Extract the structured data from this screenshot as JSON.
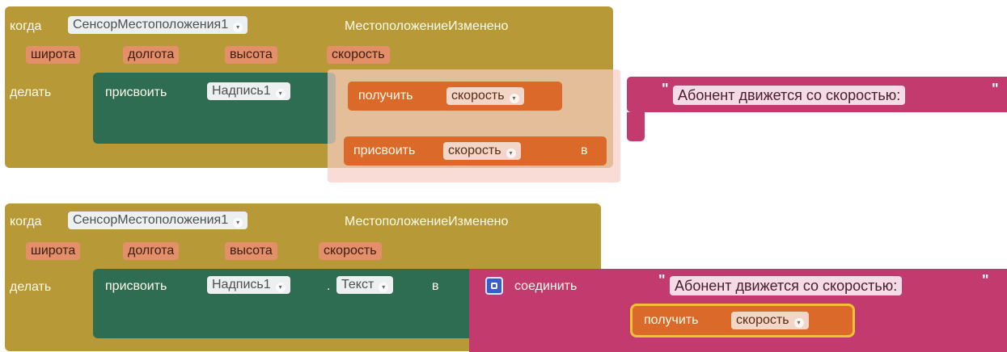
{
  "top_example": {
    "event_prefix": "когда",
    "component": "СенсорМестоположения1",
    "event_name": "МестоположениеИзменено",
    "params": [
      "широта",
      "долгота",
      "высота",
      "скорость"
    ],
    "do_label": "делать",
    "set_label": "присвоить",
    "target_component": "Надпись1",
    "get_label": "получить",
    "get_var": "скорость",
    "set_var_label": "присвоить",
    "set_var_name": "скорость",
    "set_var_to": "в",
    "text_string": "Абонент движется со скоростью:"
  },
  "bottom_example": {
    "event_prefix": "когда",
    "component": "СенсорМестоположения1",
    "event_name": "МестоположениеИзменено",
    "params": [
      "широта",
      "долгота",
      "высота",
      "скорость"
    ],
    "do_label": "делать",
    "set_label": "присвоить",
    "target_component": "Надпись1",
    "dot": ".",
    "property": "Текст",
    "to_label": "в",
    "join_label": "соединить",
    "text_string": "Абонент движется со скоростью:",
    "get_label": "получить",
    "get_var": "скорость"
  },
  "colors": {
    "event_block": "#b79a37",
    "setter_block": "#2f6d52",
    "variable_block": "#db6a2a",
    "text_block": "#c33b6e",
    "highlight": "#f1c232"
  }
}
